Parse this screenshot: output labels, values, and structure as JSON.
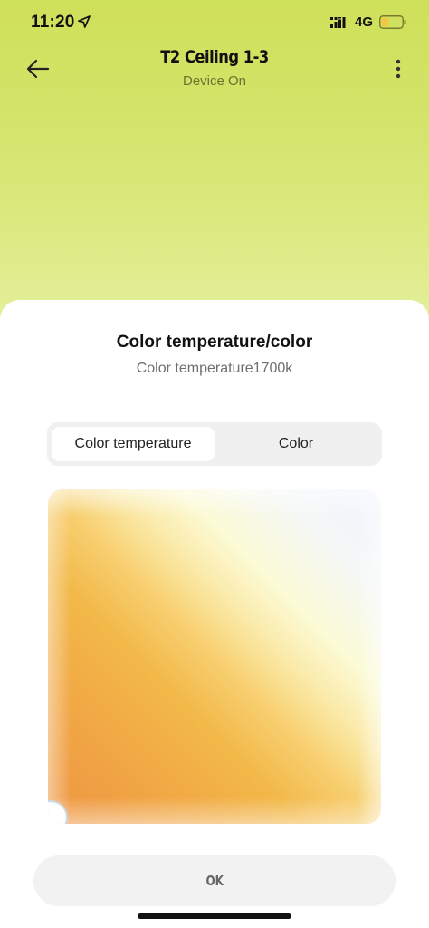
{
  "status_bar": {
    "time": "11:20",
    "network": "4G",
    "icons": {
      "location": "location-arrow-icon",
      "signal": "cellular-signal-icon",
      "battery": "battery-icon"
    },
    "battery_color": "#f2c744"
  },
  "header": {
    "title": "T2 Ceiling 1-3",
    "subtitle": "Device On",
    "back_icon": "back-arrow-icon",
    "more_icon": "more-vertical-icon"
  },
  "sheet": {
    "title": "Color temperature/color",
    "subtitle": "Color temperature1700k",
    "tabs": [
      {
        "label": "Color temperature",
        "active": true
      },
      {
        "label": "Color",
        "active": false
      }
    ],
    "picker": {
      "type": "color-temperature-gradient",
      "warm_color": "#ee9442",
      "cool_color": "#eef3fe"
    },
    "ok_label": "OK"
  },
  "colors": {
    "background_top": "#cfe05a",
    "background_bottom": "#e6f0a0",
    "sheet": "#ffffff",
    "segment_bg": "#f0f0f0",
    "ok_bg": "#f2f2f2"
  }
}
